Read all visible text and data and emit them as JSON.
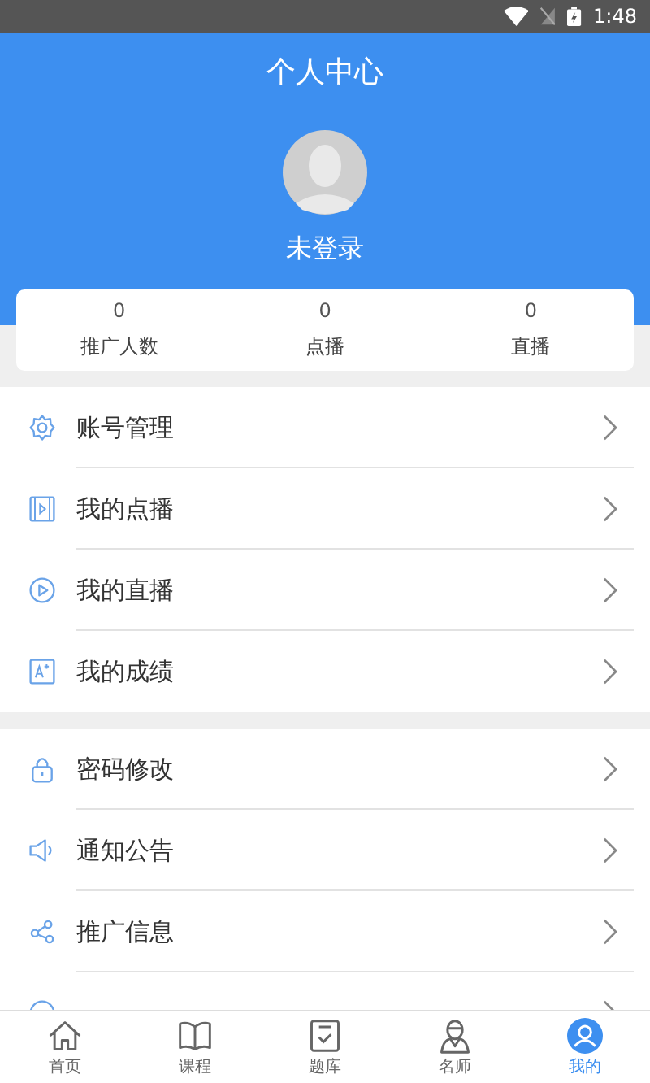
{
  "status_bar": {
    "time": "1:48"
  },
  "header": {
    "title": "个人中心",
    "username": "未登录"
  },
  "stats": [
    {
      "value": "0",
      "label": "推广人数"
    },
    {
      "value": "0",
      "label": "点播"
    },
    {
      "value": "0",
      "label": "直播"
    }
  ],
  "menu_groups": [
    {
      "items": [
        {
          "kind": "gear",
          "label": "账号管理"
        },
        {
          "kind": "film",
          "label": "我的点播"
        },
        {
          "kind": "play",
          "label": "我的直播"
        },
        {
          "kind": "score",
          "label": "我的成绩"
        }
      ]
    },
    {
      "items": [
        {
          "kind": "lock",
          "label": "密码修改"
        },
        {
          "kind": "speaker",
          "label": "通知公告"
        },
        {
          "kind": "share",
          "label": "推广信息"
        },
        {
          "kind": "circle"
        }
      ]
    }
  ],
  "tab_bar": [
    {
      "kind": "home",
      "label": "首页",
      "selected": false
    },
    {
      "kind": "book",
      "label": "课程",
      "selected": false
    },
    {
      "kind": "check",
      "label": "题库",
      "selected": false
    },
    {
      "kind": "teacher",
      "label": "名师",
      "selected": false
    },
    {
      "kind": "user",
      "label": "我的",
      "selected": true
    }
  ]
}
